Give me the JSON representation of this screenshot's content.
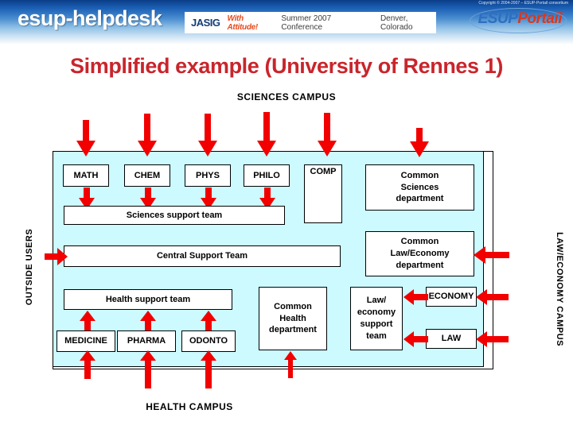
{
  "header": {
    "logo": "esup-helpdesk",
    "copyright": "Copyright © 2004-2007 – ESUP-Portail consortium",
    "jasig": {
      "name": "JASIG",
      "tagline": "With Attitude!",
      "conference": "Summer 2007 Conference",
      "city": "Denver, Colorado"
    },
    "esup_portail": {
      "part1": "ESUP",
      "part2": "Portail"
    }
  },
  "slide": {
    "title": "Simplified example (University of Rennes 1)",
    "campus_top": "SCIENCES CAMPUS",
    "campus_bottom": "HEALTH CAMPUS",
    "side_left": "OUTSIDE USERS",
    "side_right": "LAW/ECONOMY CAMPUS",
    "title_color": "#c9252c",
    "panel_color": "#ccfaff",
    "arrow_color": "#f20000"
  },
  "boxes": {
    "math": "MATH",
    "chem": "CHEM",
    "phys": "PHYS",
    "philo": "PHILO",
    "comp": "COMP",
    "common_sciences": "Common Sciences department",
    "sciences_support": "Sciences support team",
    "central_support": "Central Support Team",
    "common_law_economy": "Common Law/Economy department",
    "health_support": "Health support team",
    "medicine": "MEDICINE",
    "pharma": "PHARMA",
    "odonto": "ODONTO",
    "common_health": "Common Health department",
    "law_economy_support": "Law/ economy support team",
    "economy": "ECONOMY",
    "law": "LAW"
  },
  "box_lines": {
    "common_sciences": [
      "Common",
      "Sciences",
      "department"
    ],
    "common_law_economy": [
      "Common",
      "Law/Economy",
      "department"
    ],
    "common_health": [
      "Common",
      "Health",
      "department"
    ],
    "law_economy_support": [
      "Law/",
      "economy",
      "support",
      "team"
    ]
  }
}
